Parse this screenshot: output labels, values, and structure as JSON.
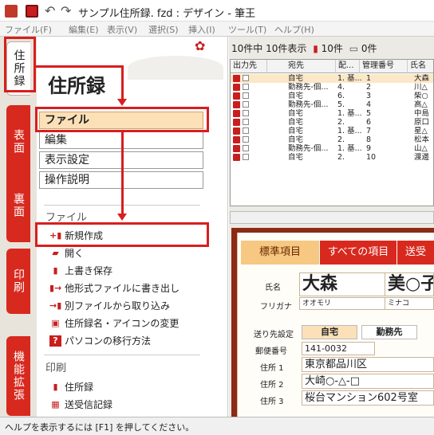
{
  "window": {
    "title": "サンプル住所録. fzd : デザイン - 筆王"
  },
  "menu": [
    "ファイル(F)",
    "編集(E)",
    "表示(V)",
    "選択(S)",
    "挿入(I)",
    "ツール(T)",
    "ヘルプ(H)"
  ],
  "tabs": [
    {
      "label": "住所録",
      "active": true
    },
    {
      "label": "表面",
      "active": false
    },
    {
      "label": "裏面",
      "active": false
    },
    {
      "label": "印刷",
      "active": false
    },
    {
      "label": "機能拡張",
      "active": false
    }
  ],
  "left_panel": {
    "title": "住所録",
    "menu_buttons": [
      "ファイル",
      "編集",
      "表示設定",
      "操作説明"
    ],
    "file_section_label": "ファイル",
    "file_commands": [
      "新規作成",
      "開く",
      "上書き保存",
      "他形式ファイルに書き出し",
      "別ファイルから取り込み",
      "住所録名・アイコンの変更",
      "パソコンの移行方法"
    ],
    "print_section_label": "印刷",
    "print_commands": [
      "住所録",
      "送受信記録"
    ]
  },
  "list": {
    "summary": "10件中 10件表示",
    "print_count": "10件",
    "tray_label": "0件",
    "columns": [
      "出力先",
      "宛先",
      "配...",
      "管理番号",
      "氏名"
    ],
    "rows": [
      [
        "自宅",
        "1. 基...",
        "1",
        "大森"
      ],
      [
        "勤務先-個...",
        "4.",
        "2",
        "川△"
      ],
      [
        "自宅",
        "6.",
        "3",
        "柴○"
      ],
      [
        "勤務先-個...",
        "5.",
        "4",
        "高△"
      ],
      [
        "自宅",
        "1. 基...",
        "5",
        "中島"
      ],
      [
        "自宅",
        "2.",
        "6",
        "原口"
      ],
      [
        "自宅",
        "1. 基...",
        "7",
        "星△"
      ],
      [
        "自宅",
        "2.",
        "8",
        "松本"
      ],
      [
        "勤務先-個...",
        "1. 基...",
        "9",
        "山△"
      ],
      [
        "自宅",
        "2.",
        "10",
        "渡邊"
      ]
    ]
  },
  "card": {
    "tabs": [
      "標準項目",
      "すべての項目",
      "送受"
    ],
    "name_label": "氏名",
    "last_name": "大森",
    "first_name": "美○子",
    "furigana_label": "フリガナ",
    "furigana_last": "オオモリ",
    "furigana_first": "ミナコ",
    "dest_label": "送り先設定",
    "dest_home": "自宅",
    "dest_work": "勤務先",
    "zip_label": "郵便番号",
    "zip": "141-0032",
    "addr1_label": "住所 1",
    "addr1": "東京都品川区",
    "addr2_label": "住所 2",
    "addr2": "大崎○-△-□",
    "addr3_label": "住所 3",
    "addr3": "桜台マンション602号室"
  },
  "status": "ヘルプを表示するには [F1] を押してください。",
  "colors": {
    "accent_red": "#d8291f",
    "highlight": "#fbe0b8",
    "annotation": "#d81e1e"
  }
}
